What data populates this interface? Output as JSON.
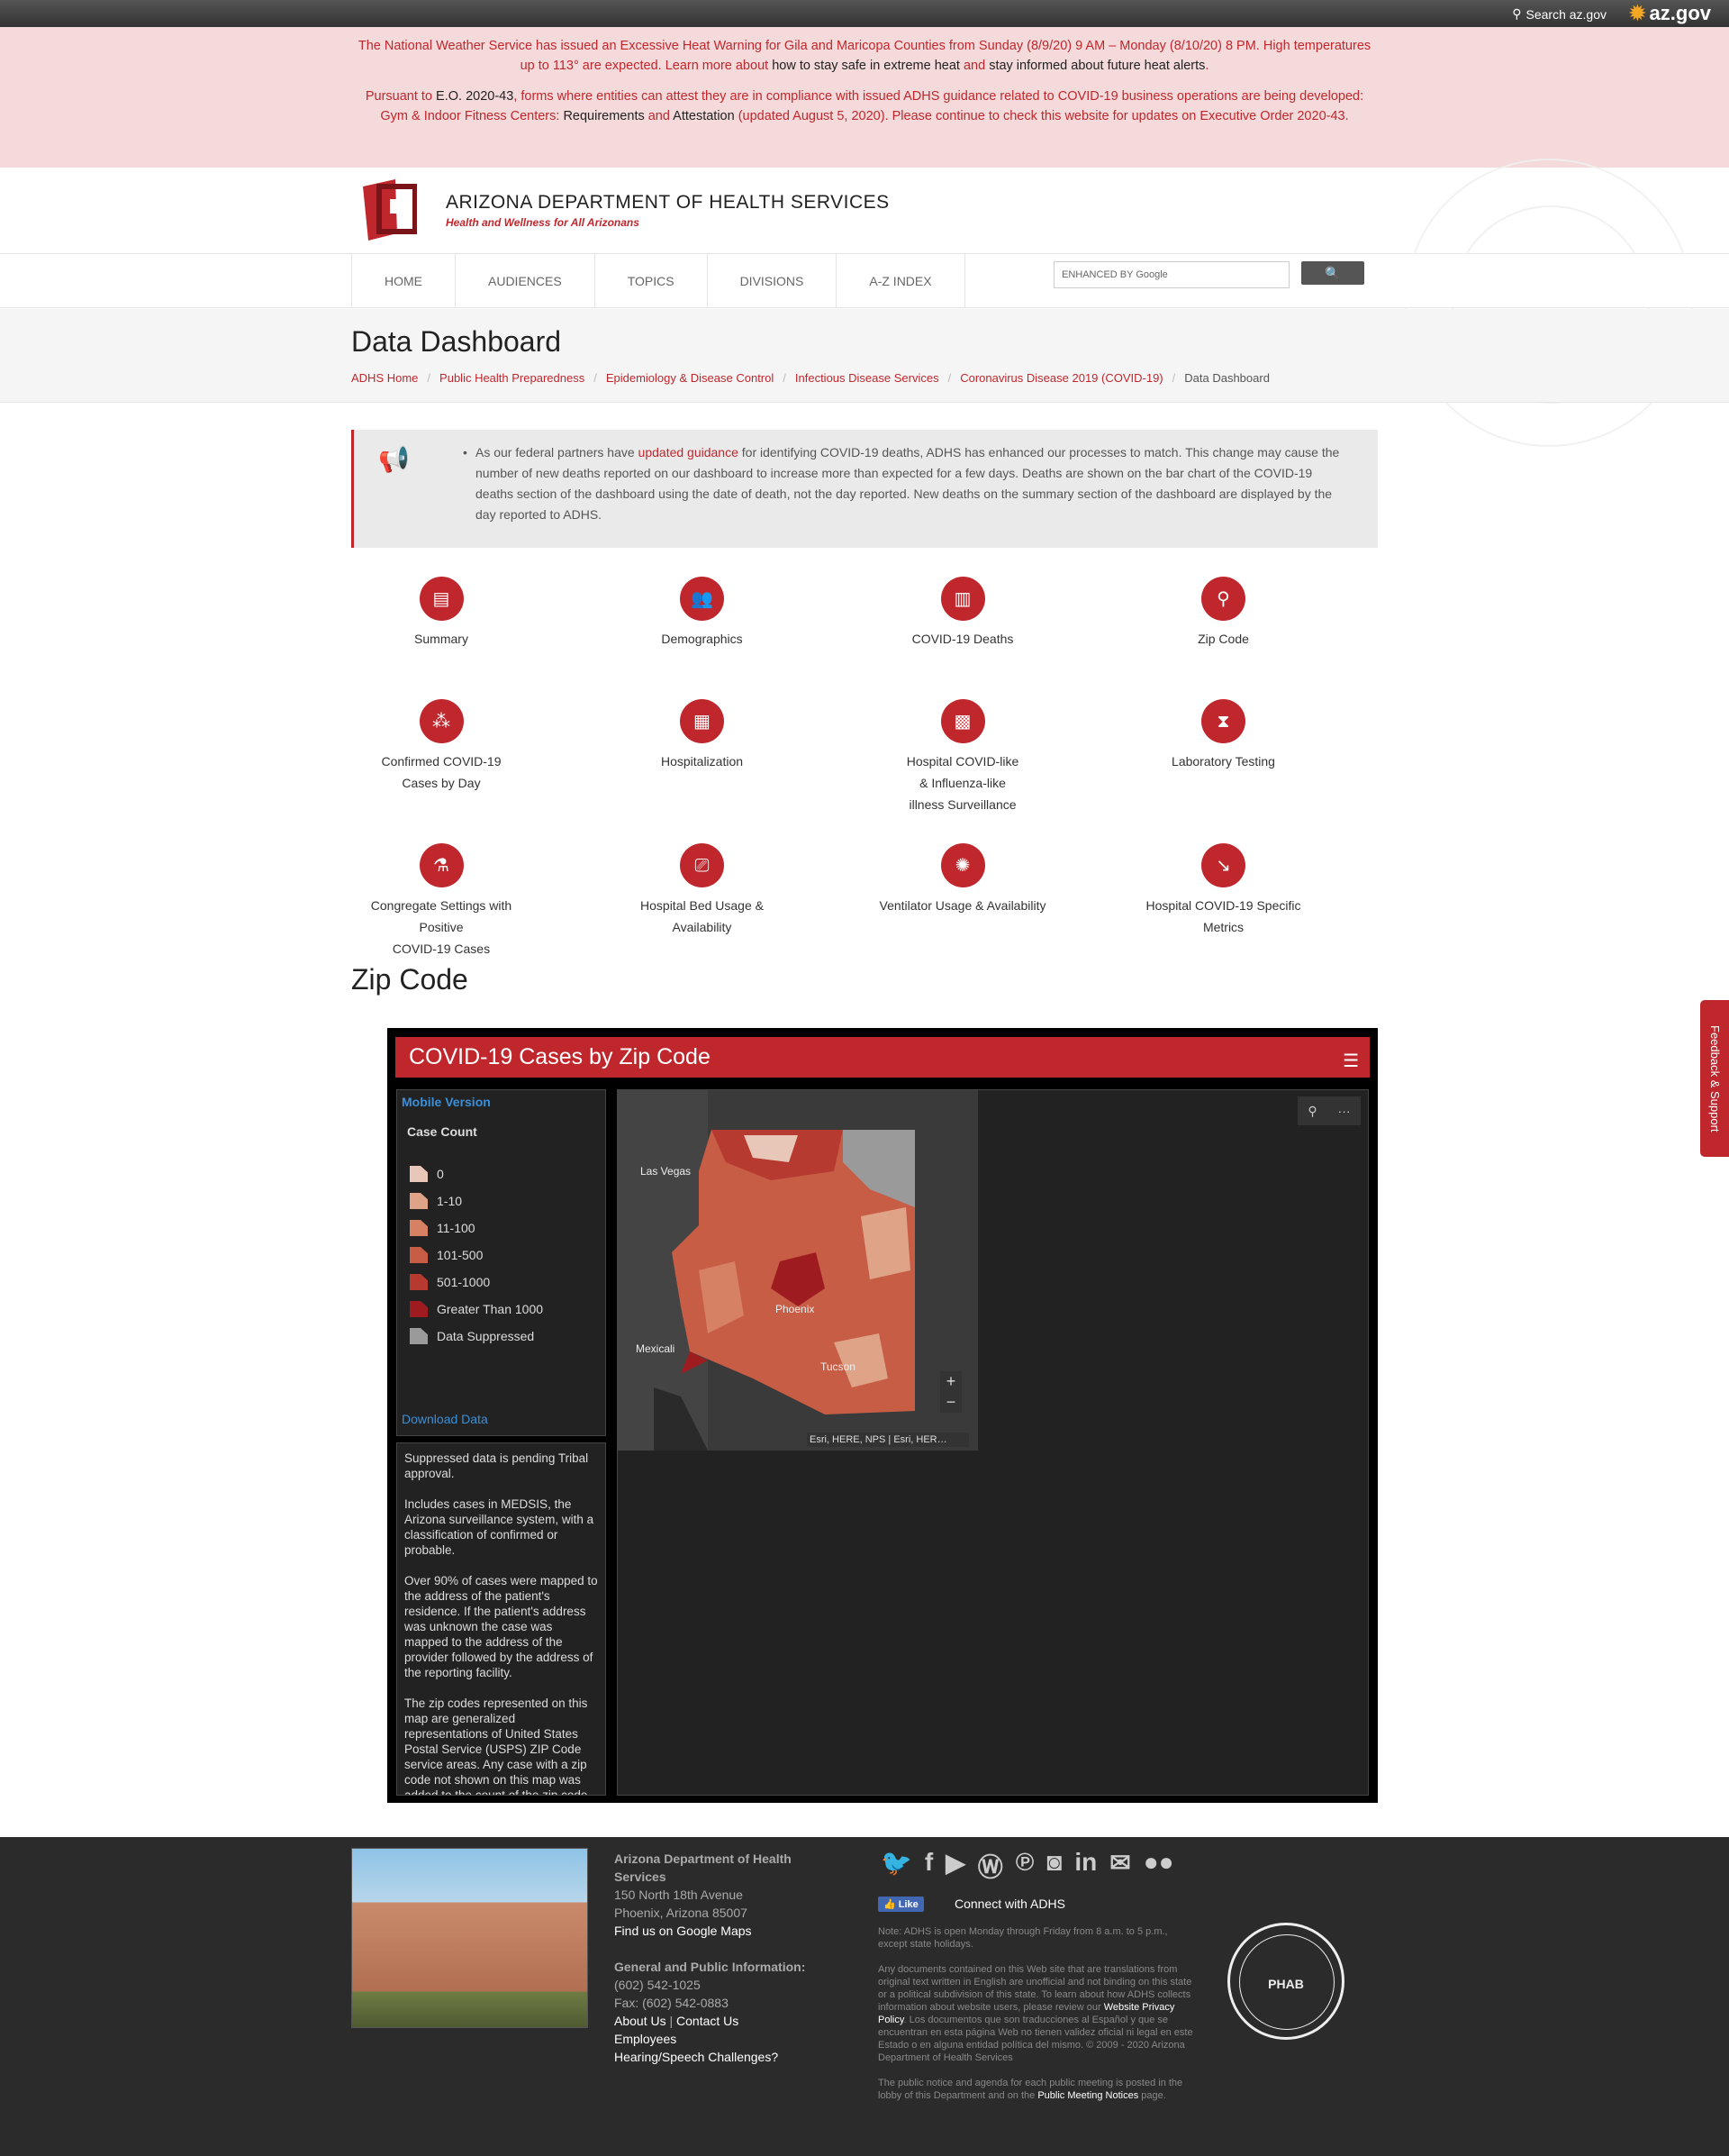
{
  "topbar": {
    "search_label": "Search az.gov",
    "azgov_label": "az.gov"
  },
  "alert": {
    "p1_a": "The National Weather Service has issued an Excessive Heat Warning for Gila and Maricopa Counties from Sunday (8/9/20) 9 AM – Monday (8/10/20) 8 PM. High temperatures up to 113° are expected. Learn more about ",
    "p1_link1": "how to stay safe in extreme heat",
    "p1_mid": " and ",
    "p1_link2": "stay informed about future heat alerts",
    "p1_end": ".",
    "p2_a": "Pursuant to ",
    "p2_link1": "E.O. 2020-43",
    "p2_b": ", forms where entities can attest they are in compliance with issued ADHS guidance related to COVID-19 business operations are being developed: Gym & Indoor Fitness Centers: ",
    "p2_link2": "Requirements",
    "p2_c": " and ",
    "p2_link3": "Attestation",
    "p2_d": " (updated August 5, 2020). Please continue to check this website for updates on Executive Order 2020-43."
  },
  "header": {
    "title": "ARIZONA DEPARTMENT OF HEALTH SERVICES",
    "tagline": "Health and Wellness for All Arizonans"
  },
  "nav": {
    "items": [
      "HOME",
      "AUDIENCES",
      "TOPICS",
      "DIVISIONS",
      "A-Z INDEX"
    ],
    "search_placeholder": "ENHANCED BY Google",
    "search_button": "🔍"
  },
  "page": {
    "title": "Data Dashboard",
    "breadcrumbs": [
      "ADHS Home",
      "Public Health Preparedness",
      "Epidemiology & Disease Control",
      "Infectious Disease Services",
      "Coronavirus Disease 2019 (COVID-19)",
      "Data Dashboard"
    ]
  },
  "notice": {
    "text_a": "As our federal partners have ",
    "link": "updated guidance",
    "text_b": " for identifying COVID-19 deaths, ADHS has enhanced our processes to match. This change may cause the number of new deaths reported on our dashboard to increase more than expected for a few days. Deaths are shown on the bar chart of the COVID-19 deaths section of the dashboard using the date of death, not the day reported. New deaths on the summary section of the dashboard are displayed by the day reported to ADHS."
  },
  "tiles": [
    {
      "label": "Summary",
      "icon": "document-icon",
      "glyph": "▤"
    },
    {
      "label": "Demographics",
      "icon": "people-icon",
      "glyph": "👥"
    },
    {
      "label": "COVID-19 Deaths",
      "icon": "bar-chart-icon",
      "glyph": "▥"
    },
    {
      "label": "Zip Code",
      "icon": "location-pin-icon",
      "glyph": "⚲"
    },
    {
      "label": "Confirmed COVID-19\nCases by Day",
      "icon": "network-icon",
      "glyph": "⁂"
    },
    {
      "label": "Hospitalization",
      "icon": "hospital-icon",
      "glyph": "▦"
    },
    {
      "label": "Hospital COVID-like\n& Influenza-like\nillness Surveillance",
      "icon": "building-icon",
      "glyph": "▩"
    },
    {
      "label": "Laboratory Testing",
      "icon": "test-tubes-icon",
      "glyph": "⧗"
    },
    {
      "label": "Congregate Settings with Positive\nCOVID-19 Cases",
      "icon": "microscope-icon",
      "glyph": "⚗"
    },
    {
      "label": "Hospital Bed Usage & Availability",
      "icon": "bed-icon",
      "glyph": "⎚"
    },
    {
      "label": "Ventilator Usage & Availability",
      "icon": "ventilator-icon",
      "glyph": "✺"
    },
    {
      "label": "Hospital COVID-19 Specific Metrics",
      "icon": "trend-chart-icon",
      "glyph": "↘"
    }
  ],
  "zip_section": {
    "heading": "Zip Code"
  },
  "embed": {
    "title": "COVID-19 Cases by Zip Code",
    "mobile_version": "Mobile Version",
    "legend_title": "Case Count",
    "legend": [
      {
        "label": "0",
        "color": "#e8c7b8"
      },
      {
        "label": "1-10",
        "color": "#dfa488"
      },
      {
        "label": "11-100",
        "color": "#d68064"
      },
      {
        "label": "101-500",
        "color": "#c85d46"
      },
      {
        "label": "501-1000",
        "color": "#b63a30"
      },
      {
        "label": "Greater Than 1000",
        "color": "#9e1c20"
      },
      {
        "label": "Data Suppressed",
        "color": "#9a9a9a"
      }
    ],
    "download": "Download Data",
    "notes": [
      "Suppressed data is pending Tribal approval.",
      "Includes cases in MEDSIS, the Arizona surveillance system, with a classification of confirmed or probable.",
      "Over 90% of cases were mapped to the address of the patient's residence.  If the patient's address was unknown the case was mapped to the address of the provider followed by the address of the reporting facility.",
      "The zip codes represented on this map are generalized representations of United States Postal Service (USPS) ZIP Code service areas. Any case with a zip code not shown on this map was added to the count of the zip code"
    ],
    "map_labels": {
      "lasvegas": "Las Vegas",
      "phoenix": "Phoenix",
      "mexicali": "Mexicali",
      "tucson": "Tucson"
    },
    "attribution": "Esri, HERE, NPS | Esri, HER…",
    "zoom_in": "+",
    "zoom_out": "−"
  },
  "feedback": "Feedback & Support",
  "footer": {
    "org": "Arizona Department of Health Services",
    "addr1": "150 North 18th Avenue",
    "addr2": "Phoenix, Arizona 85007",
    "maps_link": "Find us on Google Maps",
    "gen_heading": "General and Public Information:",
    "phone": "(602) 542-1025",
    "fax": "Fax: (602) 542-0883",
    "about": "About Us",
    "contact": "Contact Us",
    "employees": "Employees",
    "hearing": "Hearing/Speech Challenges?",
    "like": "Like",
    "connect": "Connect with ADHS",
    "note1": "Note: ADHS is open Monday through Friday from 8 a.m. to 5 p.m., except state holidays.",
    "note2_a": "Any documents contained on this Web site that are translations from original text written in English are unofficial and not binding on this state or a political subdivision of this state. To learn about how ADHS collects information about website users, please review our ",
    "note2_link": "Website Privacy Policy",
    "note2_b": ". Los documentos que son traducciones al Español y que se encuentran en esta página Web no tienen validez oficial ni legal en este Estado o en alguna entidad política del mismo. © 2009 - 2020 Arizona Department of Health Services",
    "note3_a": "The public notice and agenda for each public meeting is posted in the lobby of this Department and on the ",
    "note3_link": "Public Meeting Notices",
    "note3_b": " page.",
    "phab": "PHAB"
  }
}
